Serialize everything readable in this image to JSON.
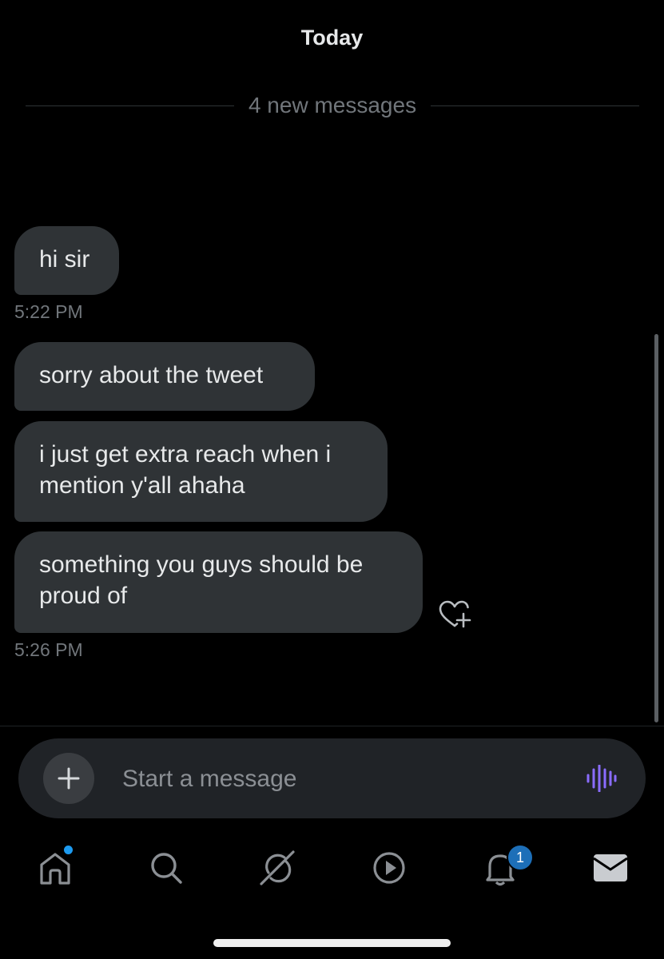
{
  "header": {
    "title": "Today"
  },
  "divider": {
    "text": "4 new messages"
  },
  "messages": [
    {
      "text": "hi sir"
    },
    {
      "text": "sorry about the tweet"
    },
    {
      "text": "i just get extra reach when i mention y'all ahaha"
    },
    {
      "text": "something you guys should be proud of"
    }
  ],
  "timestamps": [
    "5:22 PM",
    "5:26 PM"
  ],
  "composer": {
    "placeholder": "Start a message",
    "voice_icon": "audio-waveform-icon",
    "add_icon": "plus-icon"
  },
  "nav": {
    "items": [
      {
        "icon": "home-icon",
        "has_dot": true
      },
      {
        "icon": "search-icon"
      },
      {
        "icon": "grok-icon"
      },
      {
        "icon": "video-icon"
      },
      {
        "icon": "bell-icon",
        "badge": "1"
      },
      {
        "icon": "mail-icon"
      }
    ]
  },
  "colors": {
    "background": "#000000",
    "bubble": "#2f3336",
    "text": "#e7e9ea",
    "muted": "#71767b",
    "accent_badge": "#1d6fb8",
    "voice_accent": "#8a6cff"
  }
}
